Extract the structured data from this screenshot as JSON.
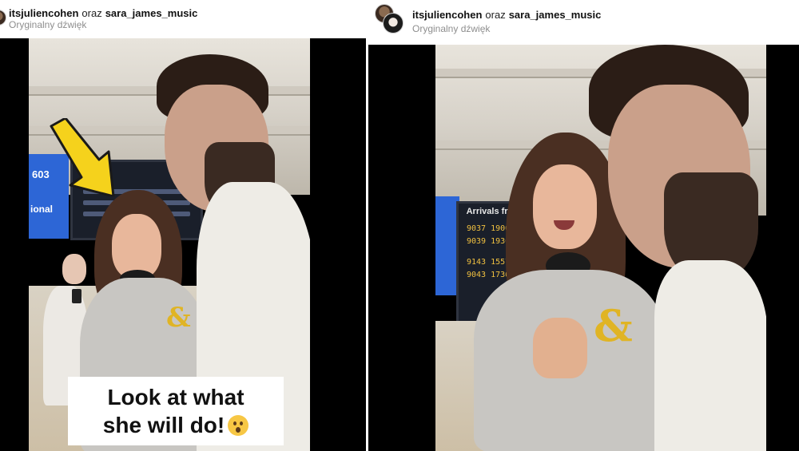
{
  "left": {
    "header": {
      "user1": "itsjuliencohen",
      "separator": "oraz",
      "user2": "sara_james_music",
      "audio": "Oryginalny dźwięk"
    },
    "caption": {
      "line1": "Look at what",
      "line2": "she will do!"
    }
  },
  "right": {
    "header": {
      "user1": "itsjuliencohen",
      "separator": "oraz",
      "user2": "sara_james_music",
      "audio": "Oryginalny dźwięk"
    },
    "board": {
      "title": "Arrivals from",
      "rows": [
        "9037 1900",
        "9039 1930",
        "9143 1557",
        "9043 1730"
      ]
    }
  },
  "colors": {
    "video_bg": "#000000",
    "arrow": "#f5d21c",
    "departure_sign": "#2d66d6"
  }
}
